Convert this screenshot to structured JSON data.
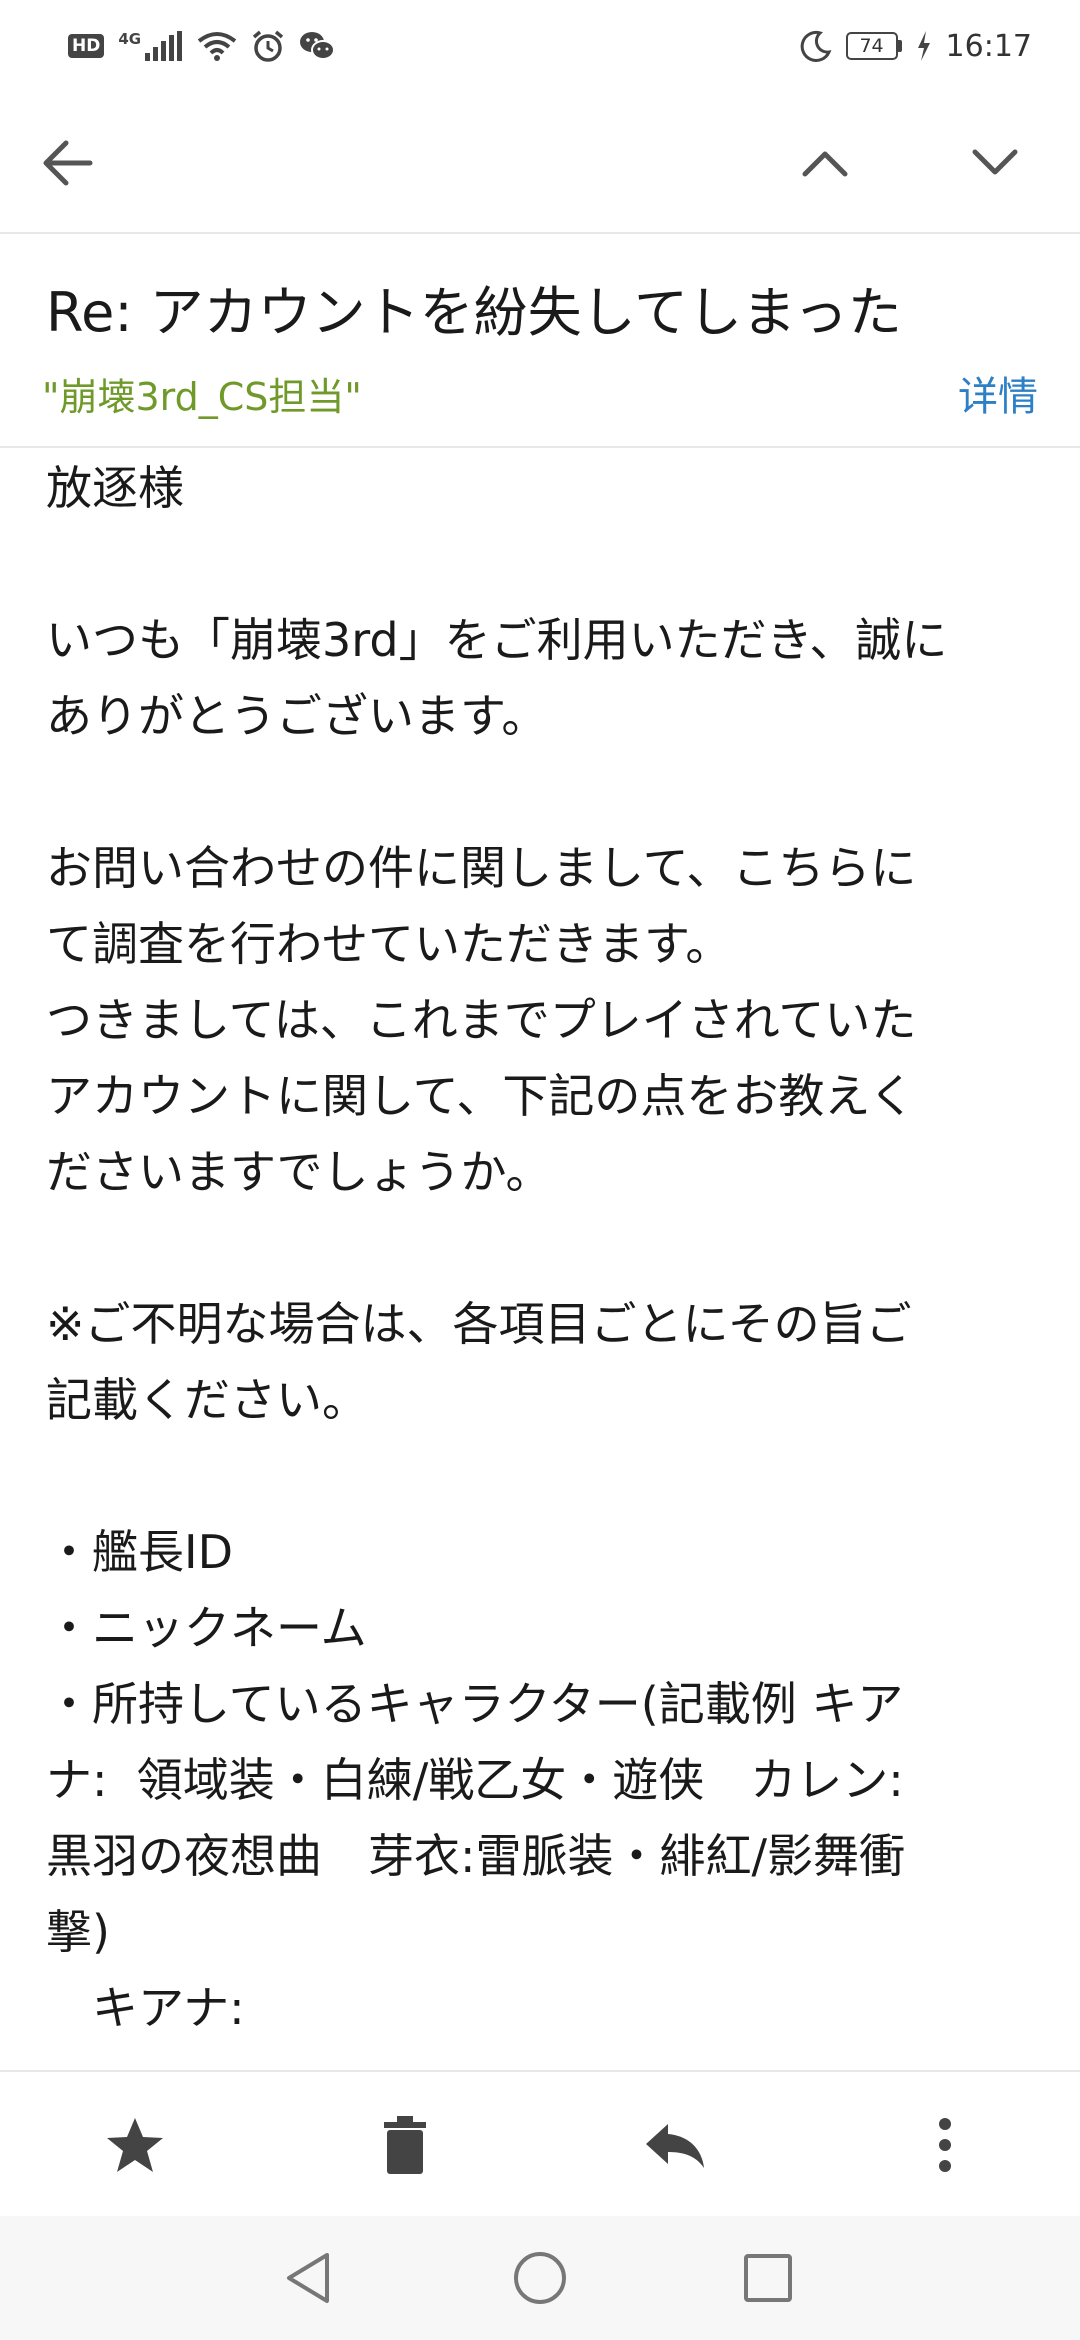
{
  "status_bar": {
    "hd": "HD",
    "network": "4G",
    "battery": "74",
    "time": "16:17",
    "icons": [
      "hd-icon",
      "signal-icon",
      "wifi-icon",
      "alarm-icon",
      "wechat-icon",
      "moon-icon",
      "battery-icon",
      "charging-icon"
    ]
  },
  "toolbar": {
    "icons": [
      "back-arrow-icon",
      "chevron-up-icon",
      "chevron-down-icon"
    ]
  },
  "header": {
    "subject": "Re: アカウントを紛失してしまった",
    "sender": "\"崩壊3rd_CS担当\"",
    "details": "详情",
    "sender_color": "#6f9a2a",
    "link_color": "#2d7fc6"
  },
  "body": {
    "lines": [
      "放逐様",
      "",
      "いつも「崩壊3rd」をご利用いただき、誠に",
      "ありがとうございます。",
      "",
      "お問い合わせの件に関しまして、こちらに",
      "て調査を行わせていただきます。",
      "つきましては、これまでプレイされていた",
      "アカウントに関して、下記の点をお教えく",
      "ださいますでしょうか。",
      "",
      "※ご不明な場合は、各項目ごとにその旨ご",
      "記載ください。",
      "",
      "・艦長ID",
      "・ニックネーム",
      "・所持しているキャラクター(記載例 キア",
      "ナ:  領域装・白練/戦乙女・遊侠　カレン:",
      "黒羽の夜想曲　芽衣:雷脈装・緋紅/影舞衝",
      "撃)",
      "　キアナ:"
    ]
  },
  "action_bar": {
    "icons": [
      "star-icon",
      "trash-icon",
      "reply-icon",
      "more-vert-icon"
    ]
  },
  "nav_bar": {
    "icons": [
      "nav-back-icon",
      "nav-home-icon",
      "nav-recents-icon"
    ]
  }
}
